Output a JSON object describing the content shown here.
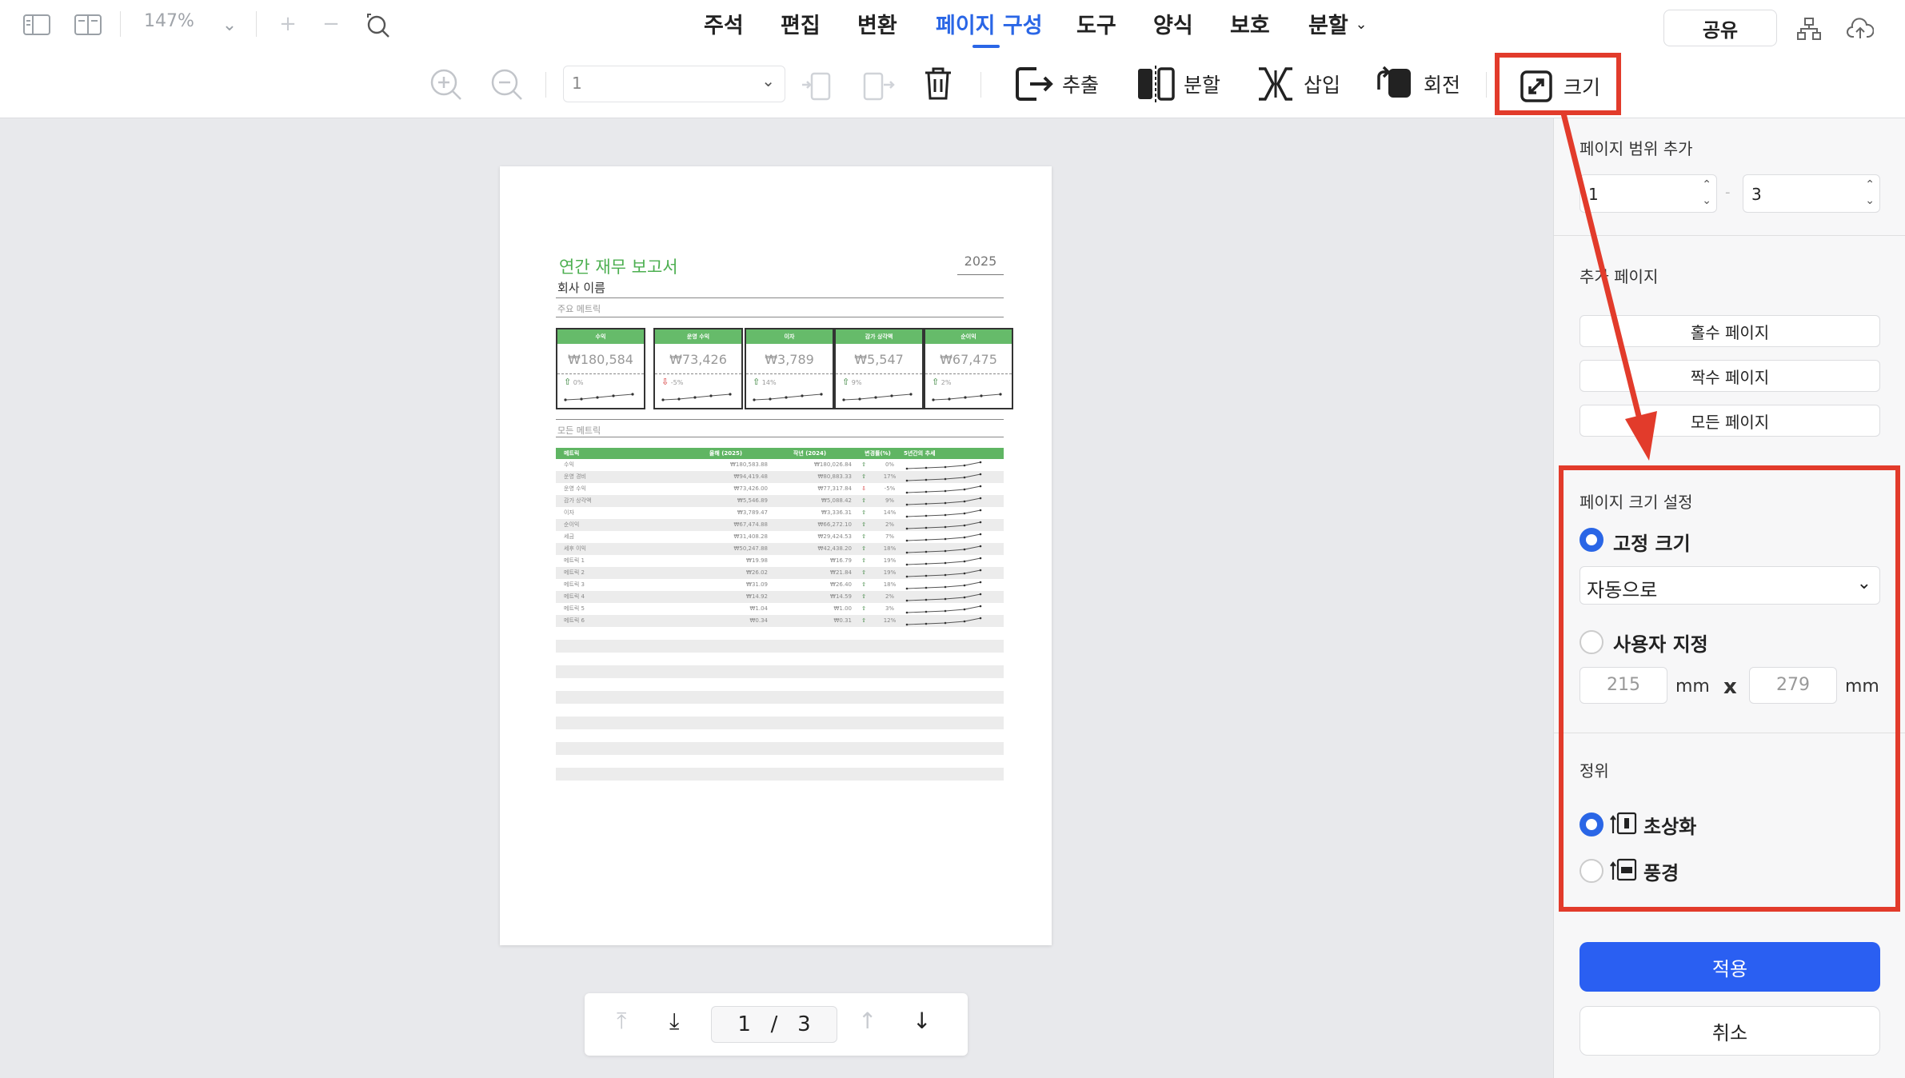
{
  "topbar": {
    "zoom": "147%",
    "tabs": [
      "주석",
      "편집",
      "변환",
      "페이지 구성",
      "도구",
      "양식",
      "보호",
      "분할"
    ],
    "active_tab": "페이지 구성",
    "share_label": "공유"
  },
  "toolbar": {
    "page_select": "1",
    "extract": "추출",
    "split": "분할",
    "insert": "삽입",
    "rotate": "회전",
    "size": "크기"
  },
  "document": {
    "title": "연간 재무 보고서",
    "company": "회사 이름",
    "year": "2025",
    "key_metrics_label": "주요 메트릭",
    "all_metrics_label": "모든 메트릭",
    "cards": [
      {
        "title": "수익",
        "value": "₩180,584",
        "pct": "0%",
        "dir": "up"
      },
      {
        "title": "운영 수익",
        "value": "₩73,426",
        "pct": "-5%",
        "dir": "down"
      },
      {
        "title": "이자",
        "value": "₩3,789",
        "pct": "14%",
        "dir": "up"
      },
      {
        "title": "감가 상각액",
        "value": "₩5,547",
        "pct": "9%",
        "dir": "up"
      },
      {
        "title": "순이익",
        "value": "₩67,475",
        "pct": "2%",
        "dir": "up"
      }
    ],
    "table_headers": [
      "메트릭",
      "올해 (2025)",
      "작년 (2024)",
      "변경률(%)",
      "5년간의 추세"
    ],
    "table_rows": [
      {
        "name": "수익",
        "cur": "₩180,583.88",
        "prev": "₩180,026.84",
        "pct": "0%",
        "dir": "up"
      },
      {
        "name": "운영 경비",
        "cur": "₩94,419.48",
        "prev": "₩80,883.33",
        "pct": "17%",
        "dir": "up"
      },
      {
        "name": "운영 수익",
        "cur": "₩73,426.00",
        "prev": "₩77,317.84",
        "pct": "-5%",
        "dir": "down"
      },
      {
        "name": "감가 상각액",
        "cur": "₩5,546.89",
        "prev": "₩5,088.42",
        "pct": "9%",
        "dir": "up"
      },
      {
        "name": "이자",
        "cur": "₩3,789.47",
        "prev": "₩3,336.31",
        "pct": "14%",
        "dir": "up"
      },
      {
        "name": "순이익",
        "cur": "₩67,474.88",
        "prev": "₩66,272.10",
        "pct": "2%",
        "dir": "up"
      },
      {
        "name": "세금",
        "cur": "₩31,408.28",
        "prev": "₩29,424.53",
        "pct": "7%",
        "dir": "up"
      },
      {
        "name": "세후 이익",
        "cur": "₩50,247.88",
        "prev": "₩42,438.20",
        "pct": "18%",
        "dir": "up"
      },
      {
        "name": "메트릭 1",
        "cur": "₩19.98",
        "prev": "₩16.79",
        "pct": "19%",
        "dir": "up"
      },
      {
        "name": "메트릭 2",
        "cur": "₩26.02",
        "prev": "₩21.84",
        "pct": "19%",
        "dir": "up"
      },
      {
        "name": "메트릭 3",
        "cur": "₩31.09",
        "prev": "₩26.40",
        "pct": "18%",
        "dir": "up"
      },
      {
        "name": "메트릭 4",
        "cur": "₩14.92",
        "prev": "₩14.59",
        "pct": "2%",
        "dir": "up"
      },
      {
        "name": "메트릭 5",
        "cur": "₩1.04",
        "prev": "₩1.00",
        "pct": "3%",
        "dir": "up"
      },
      {
        "name": "메트릭 6",
        "cur": "₩0.34",
        "prev": "₩0.31",
        "pct": "12%",
        "dir": "up"
      }
    ]
  },
  "pager": {
    "current": "1",
    "sep": "/",
    "total": "3"
  },
  "panel": {
    "range_label": "페이지 범위 추가",
    "range_from": "1",
    "range_dash": "-",
    "range_to": "3",
    "add_pages_label": "추가 페이지",
    "odd_pages": "홀수 페이지",
    "even_pages": "짝수 페이지",
    "all_pages": "모든 페이지",
    "size_settings_label": "페이지 크기 설정",
    "fixed_size": "고정 크기",
    "auto_option": "자동으로",
    "custom": "사용자 지정",
    "width": "215",
    "height": "279",
    "unit": "mm",
    "times": "x",
    "orientation_label": "정위",
    "portrait": "초상화",
    "landscape": "풍경",
    "apply": "적용",
    "cancel": "취소"
  },
  "colors": {
    "accent": "#2a66e6",
    "highlight": "#e23b2b",
    "green": "#5fb563",
    "apply_bg": "#2a5ff2"
  }
}
